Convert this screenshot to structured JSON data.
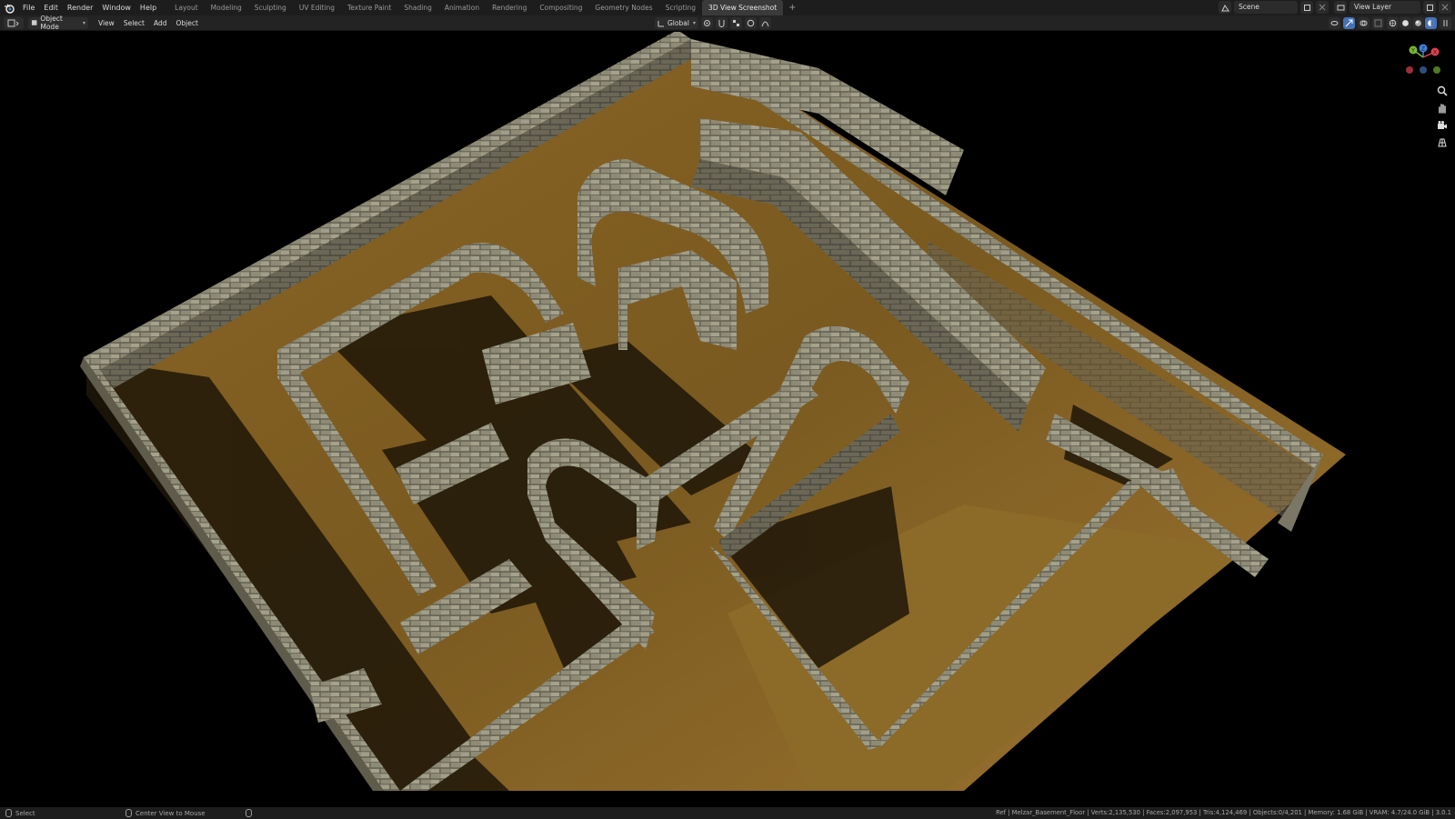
{
  "top_menu": {
    "items": [
      "File",
      "Edit",
      "Render",
      "Window",
      "Help"
    ]
  },
  "workspaces": {
    "tabs": [
      "Layout",
      "Modeling",
      "Sculpting",
      "UV Editing",
      "Texture Paint",
      "Shading",
      "Animation",
      "Rendering",
      "Compositing",
      "Geometry Nodes",
      "Scripting",
      "3D View Screenshot"
    ],
    "active": "3D View Screenshot",
    "add_label": "+"
  },
  "scene": {
    "name": "Scene"
  },
  "view_layer": {
    "name": "View Layer"
  },
  "viewport_header": {
    "mode": "Object Mode",
    "menus": [
      "View",
      "Select",
      "Add",
      "Object"
    ],
    "orientation": "Global"
  },
  "gizmo": {
    "x": "X",
    "y": "Y",
    "z": "Z"
  },
  "status_bar": {
    "left_action": "Select",
    "middle_action": "Center View to Mouse",
    "stats": "Ref | Melzar_Basement_Floor | Verts:2,135,530 | Faces:2,097,953 | Tris:4,124,469 | Objects:0/4,201 | Memory: 1.68 GiB | VRAM: 4.7/24.0 GiB | 3.0.1"
  },
  "colors": {
    "floor": "#7a5a20",
    "floor_light": "#93702b",
    "wall_top": "#b7b49e",
    "wall_side": "#7d7a68",
    "accent": "#4772b3",
    "axis_x": "#e0404f",
    "axis_y": "#79b633",
    "axis_z": "#3f80e0"
  },
  "icons": [
    "blender-logo-icon",
    "editor-type-icon",
    "object-mode-icon",
    "transform-orientation-icon",
    "pivot-icon",
    "snap-icon",
    "proportional-edit-icon",
    "overlay-icon",
    "xray-icon",
    "shading-wireframe-icon",
    "shading-solid-icon",
    "shading-material-icon",
    "shading-rendered-icon",
    "zoom-icon",
    "pan-hand-icon",
    "camera-icon",
    "perspective-grid-icon"
  ]
}
